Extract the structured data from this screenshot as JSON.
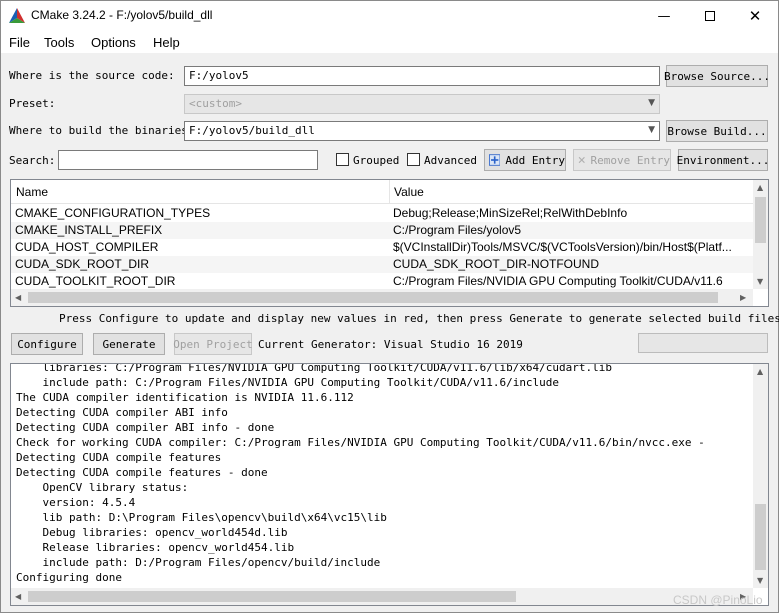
{
  "window": {
    "title": "CMake 3.24.2 - F:/yolov5/build_dll"
  },
  "menu": [
    "File",
    "Tools",
    "Options",
    "Help"
  ],
  "source": {
    "label": "Where is the source code:",
    "value": "F:/yolov5",
    "button": "Browse Source..."
  },
  "preset": {
    "label": "Preset:",
    "value": "<custom>"
  },
  "build": {
    "label": "Where to build the binaries:",
    "value": "F:/yolov5/build_dll",
    "button": "Browse Build..."
  },
  "search": {
    "label": "Search:",
    "value": ""
  },
  "toolbar": {
    "grouped": "Grouped",
    "advanced": "Advanced",
    "add_entry": "Add Entry",
    "remove_entry": "Remove Entry",
    "environment": "Environment..."
  },
  "table": {
    "headers": {
      "name": "Name",
      "value": "Value"
    },
    "rows": [
      {
        "name": "CMAKE_CONFIGURATION_TYPES",
        "value": "Debug;Release;MinSizeRel;RelWithDebInfo"
      },
      {
        "name": "CMAKE_INSTALL_PREFIX",
        "value": "C:/Program Files/yolov5"
      },
      {
        "name": "CUDA_HOST_COMPILER",
        "value": "$(VCInstallDir)Tools/MSVC/$(VCToolsVersion)/bin/Host$(Platf..."
      },
      {
        "name": "CUDA_SDK_ROOT_DIR",
        "value": "CUDA_SDK_ROOT_DIR-NOTFOUND"
      },
      {
        "name": "CUDA_TOOLKIT_ROOT_DIR",
        "value": "C:/Program Files/NVIDIA GPU Computing Toolkit/CUDA/v11.6"
      }
    ]
  },
  "hint": "Press Configure to update and display new values in red, then press Generate to generate selected build files.",
  "actions": {
    "configure": "Configure",
    "generate": "Generate",
    "open_project": "Open Project",
    "generator": "Current Generator: Visual Studio 16 2019"
  },
  "log": [
    "    libraries: C:/Program Files/NVIDIA GPU Computing Toolkit/CUDA/v11.6/lib/x64/cudart.lib",
    "    include path: C:/Program Files/NVIDIA GPU Computing Toolkit/CUDA/v11.6/include",
    "The CUDA compiler identification is NVIDIA 11.6.112",
    "Detecting CUDA compiler ABI info",
    "Detecting CUDA compiler ABI info - done",
    "Check for working CUDA compiler: C:/Program Files/NVIDIA GPU Computing Toolkit/CUDA/v11.6/bin/nvcc.exe -",
    "Detecting CUDA compile features",
    "Detecting CUDA compile features - done",
    "    OpenCV library status:",
    "    version: 4.5.4",
    "    lib path: D:\\Program Files\\opencv\\build\\x64\\vc15\\lib",
    "    Debug libraries: opencv_world454d.lib",
    "    Release libraries: opencv_world454.lib",
    "    include path: D:/Program Files/opencv/build/include",
    "Configuring done"
  ],
  "watermark": "CSDN @PinoLio",
  "colors": {
    "accent": "#0078d7",
    "add_icon": "#2a62c9"
  }
}
